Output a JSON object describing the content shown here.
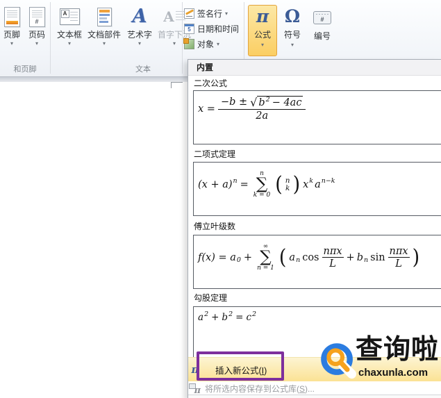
{
  "ribbon": {
    "buttons": {
      "footer": "页脚",
      "page_number": "页码",
      "text_box": "文本框",
      "quick_parts": "文档部件",
      "word_art": "艺术字",
      "drop_cap": "首字下沉",
      "signature_line": "签名行",
      "date_time": "日期和时间",
      "object": "对象",
      "equation": "公式",
      "symbol": "符号",
      "number": "编号"
    },
    "group_labels": {
      "header_footer": "和页脚",
      "text": "文本"
    }
  },
  "icons": {
    "pi": "π",
    "omega": "Ω",
    "hash": "#",
    "chevron_down": "▾",
    "textbox_glyph": "A",
    "wordart_glyph": "A",
    "dropcap_glyph": "A",
    "datetime_glyph": "5"
  },
  "dropdown": {
    "header": "内置",
    "menu": {
      "insert_new_prefix": "插入新公式(",
      "insert_new_accel": "I",
      "insert_new_suffix": ")",
      "save_prefix": "将所选内容保存到公式库(",
      "save_accel": "S",
      "save_suffix": ")..."
    }
  },
  "equations": {
    "quadratic": {
      "label": "二次公式",
      "lhs": "x =",
      "num_pre": "−b ±",
      "sqrt_sign": "√",
      "rad_base": "b",
      "rad_sup": "2",
      "rad_rest": "− 4ac",
      "den": "2a"
    },
    "binomial": {
      "label": "二项式定理",
      "lhs": "(x + a)",
      "lhs_sup": "n",
      "eq": "=",
      "sum": "∑",
      "sum_top": "n",
      "sum_bot": "k = 0",
      "paren_l": "(",
      "choose_top": "n",
      "choose_bot": "k",
      "paren_r": ")",
      "x": "x",
      "x_sup": "k",
      "a": "a",
      "a_sup": "n−k"
    },
    "fourier": {
      "label": "傅立叶级数",
      "lhs": "f(x) = a",
      "lhs_sub": "0",
      "plus1": "+",
      "sum": "∑",
      "sum_top": "∞",
      "sum_bot": "n = 1",
      "paren_l": "(",
      "a": "a",
      "a_sub": "n",
      "cos": "cos",
      "frac1_num": "nπx",
      "frac1_den": "L",
      "plus2": "+",
      "b": "b",
      "b_sub": "n",
      "sin": "sin",
      "frac2_num": "nπx",
      "frac2_den": "L",
      "paren_r": ")"
    },
    "pythagorean": {
      "label": "勾股定理",
      "a": "a",
      "a_sup": "2",
      "plus": "+",
      "b": "b",
      "b_sup": "2",
      "eq": "=",
      "c": "c",
      "c_sup": "2"
    }
  },
  "watermark": {
    "title": "查询啦",
    "domain": "chaxunla.com"
  },
  "colors": {
    "equation_button_highlight": "#fbce63",
    "equation_button_border": "#e2a33d",
    "menu_highlight": "#fbe294",
    "annotation_purple": "#7e2f9d",
    "logo_blue": "#2b7ce0",
    "logo_orange": "#f6a21d",
    "ribbon_glyph_blue": "#3c5c96",
    "eqbox_border": "#565b63"
  }
}
